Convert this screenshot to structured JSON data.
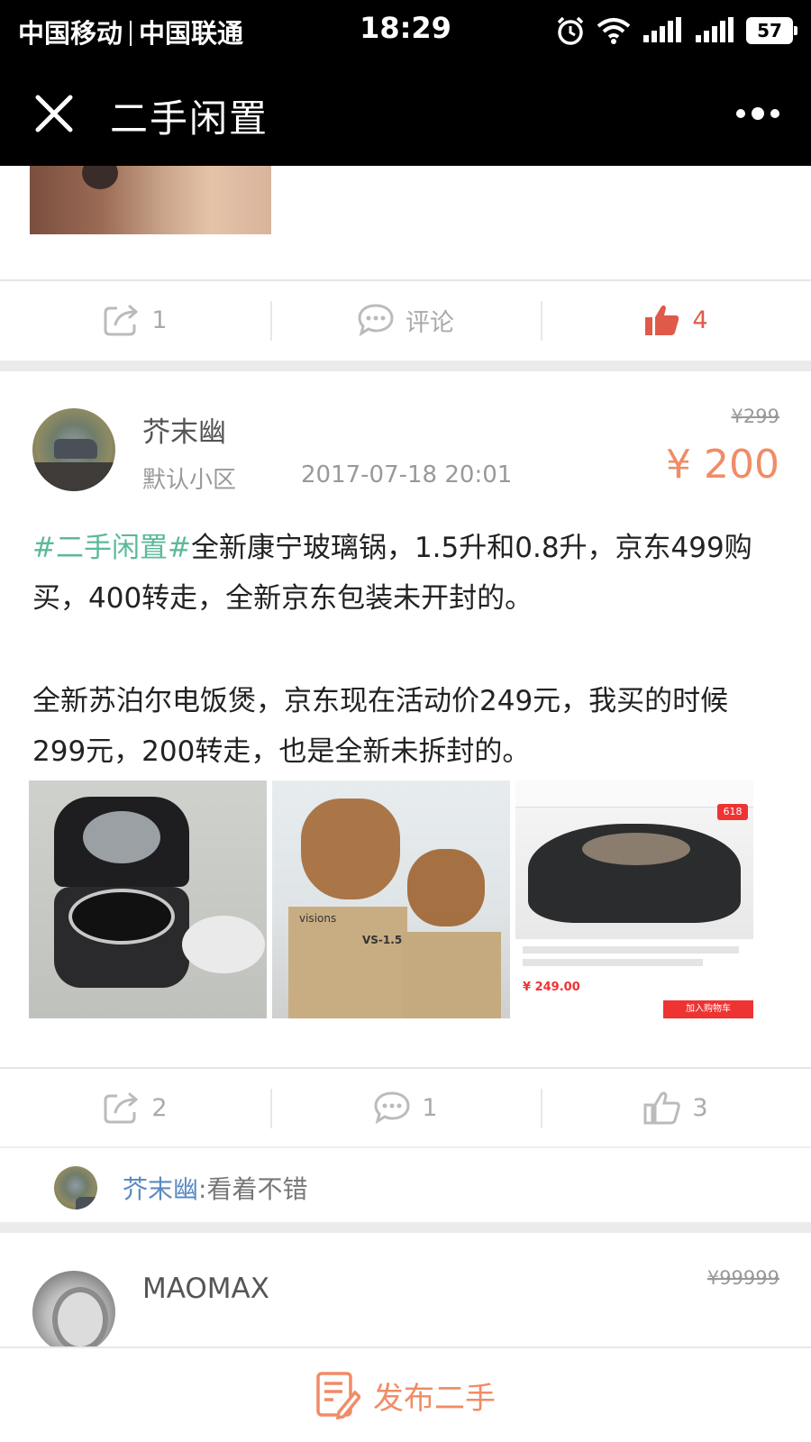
{
  "status_bar": {
    "carrier_1": "中国移动",
    "carrier_2": "中国联通",
    "time": "18:29",
    "battery": "57"
  },
  "nav": {
    "title": "二手闲置"
  },
  "prev_post_actions": {
    "repost_count": "1",
    "comment_label": "评论",
    "like_count": "4"
  },
  "post": {
    "username": "芥末幽",
    "community": "默认小区",
    "time": "2017-07-18 20:01",
    "original_price": "¥299",
    "price": "¥ 200",
    "topic": "#二手闲置#",
    "text_1": "全新康宁玻璃锅，1.5升和0.8升，京东499购买，400转走，全新京东包装未开封的。",
    "text_2": "全新苏泊尔电饭煲，京东现在活动价249元，我买的时候299元，200转走，也是全新未拆封的。",
    "photo_labels": {
      "visions_box": "VS-1.5",
      "visions_brand": "visions",
      "shop_tag": "618",
      "shop_price": "¥ 249.00",
      "shop_cart": "加入购物车"
    },
    "actions": {
      "repost_count": "2",
      "comment_count": "1",
      "like_count": "3"
    },
    "comment": {
      "user": "芥末幽",
      "text": ":看着不错"
    }
  },
  "next_post": {
    "username": "MAOMAX",
    "original_price": "¥99999"
  },
  "bottom_bar": {
    "publish_label": "发布二手"
  },
  "colors": {
    "accent_price": "#f08c66",
    "topic_green": "#5cb99a",
    "like_red": "#e05a4a",
    "link_blue": "#5b8ac1"
  }
}
